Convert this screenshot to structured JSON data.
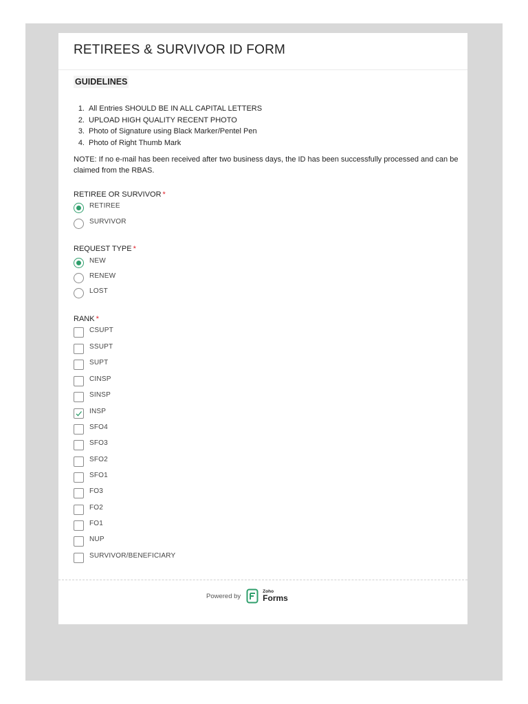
{
  "form": {
    "title": "RETIREES & SURVIVOR ID FORM"
  },
  "guidelines": {
    "heading": "GUIDELINES",
    "items": [
      {
        "num": "1.",
        "text": "All Entries SHOULD BE IN ALL CAPITAL LETTERS"
      },
      {
        "num": "2.",
        "text": "UPLOAD HIGH QUALITY RECENT  PHOTO"
      },
      {
        "num": "3.",
        "text": "Photo of Signature using Black Marker/Pentel Pen"
      },
      {
        "num": "4.",
        "text": "Photo of Right Thumb Mark"
      }
    ],
    "note": "NOTE: If no e-mail has been received after two business days, the ID has been successfully processed and can be claimed from the RBAS."
  },
  "retiree_or_survivor": {
    "label": "RETIREE OR SURVIVOR",
    "required_mark": "*",
    "options": [
      "RETIREE",
      "SURVIVOR"
    ],
    "selected": "RETIREE"
  },
  "request_type": {
    "label": "REQUEST TYPE",
    "required_mark": "*",
    "options": [
      "NEW",
      "RENEW",
      "LOST"
    ],
    "selected": "NEW"
  },
  "rank": {
    "label": "RANK",
    "required_mark": "*",
    "options": [
      "CSUPT",
      "SSUPT",
      "SUPT",
      "CINSP",
      "SINSP",
      "INSP",
      "SFO4",
      "SFO3",
      "SFO2",
      "SFO1",
      "FO3",
      "FO2",
      "FO1",
      "NUP",
      "SURVIVOR/BENEFICIARY"
    ],
    "checked": [
      "INSP"
    ]
  },
  "footer": {
    "powered_by": "Powered by",
    "logo_brand": "Zoho",
    "logo_product": "Forms"
  },
  "colors": {
    "accent": "#2e9e6b",
    "required": "#e0212a",
    "backdrop": "#d8d8d8"
  }
}
